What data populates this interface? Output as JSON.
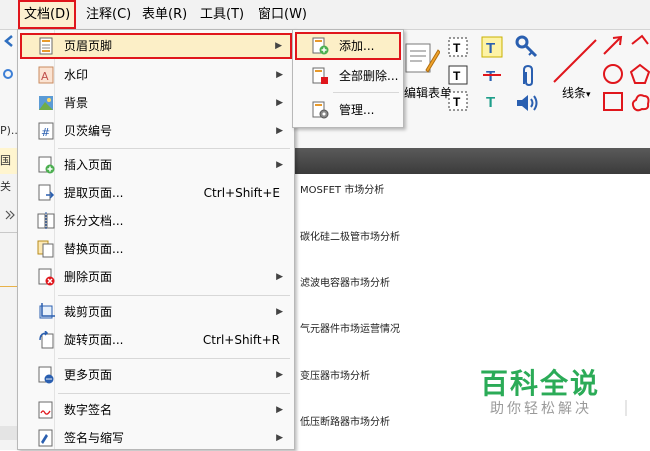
{
  "menubar": {
    "items": [
      "文档(D)",
      "注释(C)",
      "表单(R)",
      "工具(T)",
      "窗口(W)"
    ],
    "active_index": 0
  },
  "ribbon": {
    "form_label": "编辑表单",
    "lines_label": "线条",
    "lines_dropdown": "▾"
  },
  "left_fragments": {
    "p_text": "P)...",
    "tab_text": "国关"
  },
  "document": {
    "lines": [
      "MOSFET 市场分析",
      "碳化硅二极管市场分析",
      "滤波电容器市场分析",
      "气元器件市场运营情况",
      "变压器市场分析",
      "低压断路器市场分析"
    ]
  },
  "dropdown": {
    "items": [
      {
        "label": "页眉页脚",
        "shortcut": "",
        "submenu": true,
        "icon": "header-footer-icon"
      },
      {
        "label": "水印",
        "shortcut": "",
        "submenu": true,
        "icon": "watermark-icon"
      },
      {
        "label": "背景",
        "shortcut": "",
        "submenu": true,
        "icon": "background-icon"
      },
      {
        "label": "贝茨编号",
        "shortcut": "",
        "submenu": true,
        "icon": "bates-number-icon"
      },
      {
        "label": "插入页面",
        "shortcut": "",
        "submenu": true,
        "icon": "insert-page-icon"
      },
      {
        "label": "提取页面...",
        "shortcut": "Ctrl+Shift+E",
        "submenu": false,
        "icon": "extract-page-icon"
      },
      {
        "label": "拆分文档...",
        "shortcut": "",
        "submenu": false,
        "icon": "split-document-icon"
      },
      {
        "label": "替换页面...",
        "shortcut": "",
        "submenu": false,
        "icon": "replace-page-icon"
      },
      {
        "label": "删除页面",
        "shortcut": "",
        "submenu": true,
        "icon": "delete-page-icon"
      },
      {
        "label": "裁剪页面",
        "shortcut": "",
        "submenu": true,
        "icon": "crop-page-icon"
      },
      {
        "label": "旋转页面...",
        "shortcut": "Ctrl+Shift+R",
        "submenu": false,
        "icon": "rotate-page-icon"
      },
      {
        "label": "更多页面",
        "shortcut": "",
        "submenu": true,
        "icon": "more-pages-icon"
      },
      {
        "label": "数字签名",
        "shortcut": "",
        "submenu": true,
        "icon": "digital-signature-icon"
      },
      {
        "label": "签名与缩写",
        "shortcut": "",
        "submenu": true,
        "icon": "signature-initials-icon"
      }
    ]
  },
  "submenu": {
    "items": [
      {
        "label": "添加...",
        "icon": "add-header-icon"
      },
      {
        "label": "全部删除...",
        "icon": "delete-all-icon"
      },
      {
        "label": "管理...",
        "icon": "manage-icon"
      }
    ]
  },
  "watermark": {
    "main": "百科全说",
    "sub": "助你轻松解决"
  },
  "colors": {
    "highlight_border": "#e0161c",
    "highlight_fill": "#fcefc7",
    "brand_green": "#2bab57"
  }
}
